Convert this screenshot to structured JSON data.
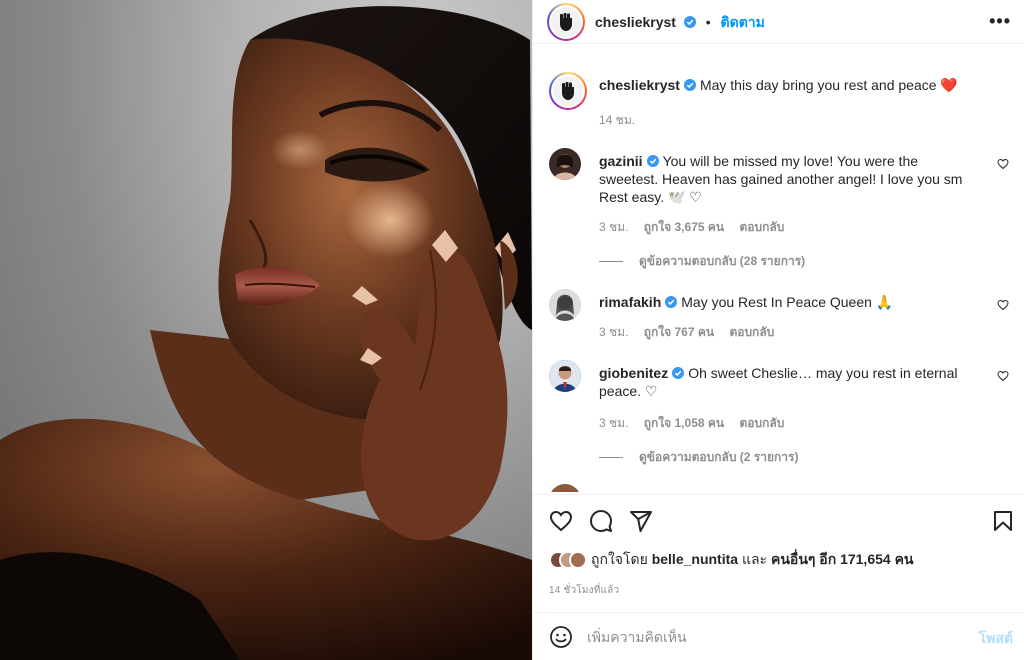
{
  "post": {
    "author": "chesliekryst",
    "follow_label": "ติดตาม",
    "dot": "•",
    "more_label": "•••",
    "caption": "May this day bring you rest and peace ❤️",
    "caption_time": "14 ชม."
  },
  "comments": [
    {
      "user": "gazinii",
      "text": "You will be missed my love! You were the sweetest. Heaven has gained another angel! I love you sm Rest easy. 🕊️ ♡",
      "time": "3 ชม.",
      "likes": "ถูกใจ 3,675 คน",
      "reply_label": "ตอบกลับ",
      "view_replies": "ดูข้อความตอบกลับ (28 รายการ)",
      "avatar_color": "#3a2a25"
    },
    {
      "user": "rimafakih",
      "text": "May you Rest In Peace Queen 🙏",
      "time": "3 ชม.",
      "likes": "ถูกใจ 767 คน",
      "reply_label": "ตอบกลับ",
      "view_replies": "",
      "avatar_color": "#c8c8c8"
    },
    {
      "user": "giobenitez",
      "text": "Oh sweet Cheslie… may you rest in eternal peace. ♡",
      "time": "3 ชม.",
      "likes": "ถูกใจ 1,058 คน",
      "reply_label": "ตอบกลับ",
      "view_replies": "ดูข้อความตอบกลับ (2 รายการ)",
      "avatar_color": "#1f3e7a"
    }
  ],
  "likes_summary": {
    "prefix": "ถูกใจโดย",
    "first_user": "belle_nuntita",
    "and": "และ",
    "others": "คนอื่นๆ อีก 171,654 คน"
  },
  "post_time": "14 ชั่วโมงที่แล้ว",
  "composer": {
    "placeholder": "เพิ่มความคิดเห็น",
    "post_label": "โพสต์"
  },
  "colors": {
    "accent": "#0095f6",
    "verified": "#3897f0",
    "heart": "#ed4956",
    "muted": "#8e8e8e"
  },
  "icons": [
    "heart-icon",
    "comment-icon",
    "share-icon",
    "bookmark-icon",
    "emoji-icon",
    "verified-icon",
    "more-icon"
  ]
}
